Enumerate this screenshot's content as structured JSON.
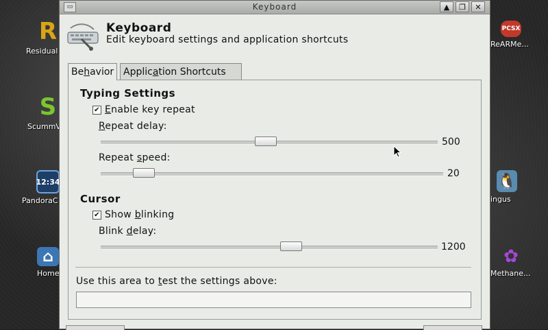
{
  "window": {
    "title": "Keyboard"
  },
  "header": {
    "title": "Keyboard",
    "subtitle": "Edit keyboard settings and application shortcuts"
  },
  "tabs": [
    {
      "label_pre": "Be",
      "label_u": "h",
      "label_post": "avior",
      "active": true
    },
    {
      "label_pre": "Applic",
      "label_u": "a",
      "label_post": "tion Shortcuts",
      "active": false
    }
  ],
  "typing": {
    "section": "Typing Settings",
    "enable_repeat": {
      "pre": "",
      "u": "E",
      "post": "nable key repeat",
      "checked": true
    },
    "repeat_delay": {
      "pre": "",
      "u": "R",
      "post": "epeat delay:",
      "value": "500",
      "fraction": 0.49
    },
    "repeat_speed": {
      "pre": "Repeat ",
      "u": "s",
      "post": "peed:",
      "value": "20",
      "fraction": 0.1
    }
  },
  "cursor": {
    "section": "Cursor",
    "show_blinking": {
      "pre": "Show ",
      "u": "b",
      "post": "linking",
      "checked": true
    },
    "blink_delay": {
      "pre": "Blink ",
      "u": "d",
      "post": "elay:",
      "value": "1200",
      "fraction": 0.57
    }
  },
  "test_area": {
    "pre": "Use this area to ",
    "u": "t",
    "post": "est the settings above:",
    "value": ""
  },
  "desktop_icons": [
    {
      "label": "Residual",
      "glyph": "R",
      "color": "#d9a516"
    },
    {
      "label": "ScummV",
      "glyph": "S",
      "color": "#7bc62d"
    },
    {
      "label": "PandoraC",
      "glyph": "12:34",
      "color": "#2a6fb8"
    },
    {
      "label": "Home",
      "glyph": "⌂",
      "color": "#3d76b4"
    },
    {
      "label": "ReARMe...",
      "glyph": "PCSX",
      "color": "#c0392b"
    },
    {
      "label": "ingus",
      "glyph": "🐧",
      "color": "#5a8bb0"
    },
    {
      "label": "Methane...",
      "glyph": "✿",
      "color": "#6a2c8a"
    }
  ]
}
